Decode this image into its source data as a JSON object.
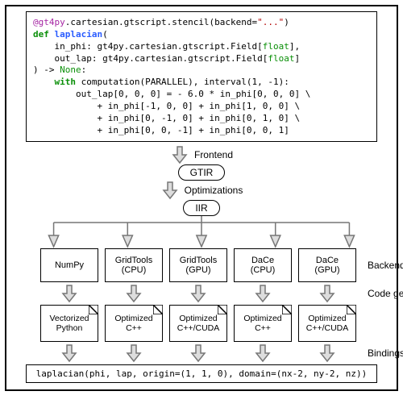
{
  "code": {
    "decorator_full": "@gt4py.cartesian.gtscript.stencil(backend=\"...\")",
    "decorator_mod": "@gt4py",
    "decorator_rest1": ".cartesian.gtscript.stencil(backend=",
    "decorator_str": "\"...\"",
    "decorator_rest2": ")",
    "def_kw": "def",
    "fn_name": "laplacian",
    "sig_open": "(",
    "arg1_name": "in_phi",
    "arg1_type": ": gt4py.cartesian.gtscript.Field[",
    "float_kw": "float",
    "arg_close": "],",
    "arg2_name": "out_lap",
    "arg2_type": ": gt4py.cartesian.gtscript.Field[",
    "arg2_close": "]",
    "sig_close_arrow": ") -> ",
    "none_kw": "None",
    "colon": ":",
    "with_kw": "with",
    "with_rest": " computation(PARALLEL), interval(1, -1):",
    "body_l1": "out_lap[0, 0, 0] = - 6.0 * in_phi[0, 0, 0] \\",
    "body_l2": "+ in_phi[-1, 0, 0] + in_phi[1, 0, 0] \\",
    "body_l3": "+ in_phi[0, -1, 0] + in_phi[0, 1, 0] \\",
    "body_l4": "+ in_phi[0, 0, -1] + in_phi[0, 0, 1]"
  },
  "labels": {
    "frontend": "Frontend",
    "optimizations": "Optimizations",
    "backends": "Backends",
    "codegen": "Code generation",
    "bindings": "Bindings"
  },
  "ir": {
    "gtir": "GTIR",
    "iir": "IIR"
  },
  "backends": [
    "NumPy",
    "GridTools\n(CPU)",
    "GridTools\n(GPU)",
    "DaCe\n(CPU)",
    "DaCe\n(GPU)"
  ],
  "generated": [
    "Vectorized\nPython",
    "Optimized\nC++",
    "Optimized\nC++/CUDA",
    "Optimized\nC++",
    "Optimized\nC++/CUDA"
  ],
  "final_call": "laplacian(phi, lap, origin=(1, 1, 0), domain=(nx-2, ny-2, nz))"
}
